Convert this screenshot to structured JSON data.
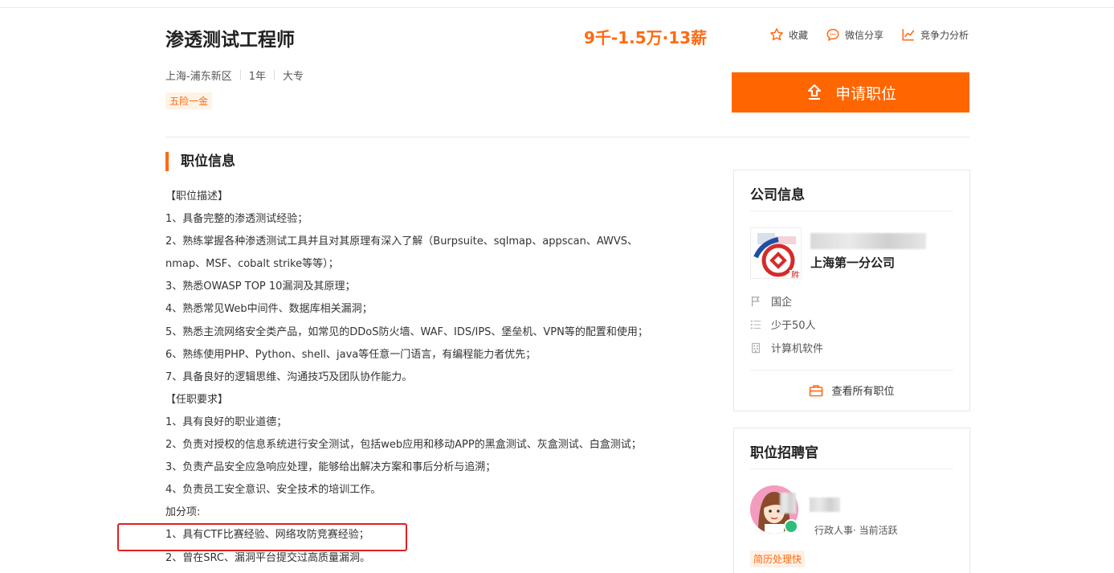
{
  "header": {
    "job_title": "渗透测试工程师",
    "salary": "9千-1.5万·13薪",
    "actions": [
      {
        "label": "收藏",
        "icon": "star-icon"
      },
      {
        "label": "微信分享",
        "icon": "chat-bubble-icon"
      },
      {
        "label": "竞争力分析",
        "icon": "chart-icon"
      }
    ],
    "meta": [
      "上海-浦东新区",
      "1年",
      "大专"
    ],
    "welfare": "五险一金",
    "apply_label": "申请职位"
  },
  "job_info": {
    "section_title": "职位信息",
    "lines": [
      "【职位描述】",
      "1、具备完整的渗透测试经验；",
      "2、熟练掌握各种渗透测试工具并且对其原理有深入了解（Burpsuite、sqlmap、appscan、AWVS、",
      "nmap、MSF、cobalt strike等等）；",
      "3、熟悉OWASP TOP 10漏洞及其原理；",
      "4、熟悉常见Web中间件、数据库相关漏洞；",
      "5、熟悉主流网络安全类产品，如常见的DDoS防火墙、WAF、IDS/IPS、堡垒机、VPN等的配置和使用；",
      "6、熟练使用PHP、Python、shell、java等任意一门语言，有编程能力者优先；",
      "7、具备良好的逻辑思维、沟通技巧及团队协作能力。",
      "【任职要求】",
      "1、具有良好的职业道德；",
      "2、负责对授权的信息系统进行安全测试，包括web应用和移动APP的黑盒测试、灰盒测试、白盒测试；",
      "3、负责产品安全应急响应处理，能够给出解决方案和事后分析与追溯；",
      "4、负责员工安全意识、安全技术的培训工作。",
      "加分项:",
      "1、具有CTF比赛经验、网络攻防竞赛经验；",
      "2、曾在SRC、漏洞平台提交过高质量漏洞。"
    ]
  },
  "company": {
    "title": "公司信息",
    "name": "上海第一分公司",
    "logo_char": "胜",
    "type": "国企",
    "size": "少于50人",
    "industry": "计算机软件",
    "view_all": "查看所有职位"
  },
  "recruiter": {
    "title": "职位招聘官",
    "role": "行政人事· 当前活跃",
    "badge": "简历处理快"
  },
  "colors": {
    "accent": "#ff6600",
    "highlight_border": "#e02020",
    "online": "#2dbe7a"
  }
}
